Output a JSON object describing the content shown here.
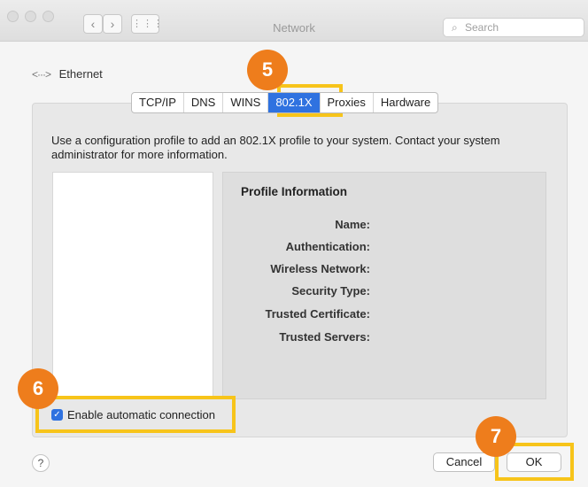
{
  "window": {
    "title": "Network"
  },
  "search": {
    "placeholder": "Search"
  },
  "breadcrumb": {
    "label": "Ethernet"
  },
  "tabs": [
    "TCP/IP",
    "DNS",
    "WINS",
    "802.1X",
    "Proxies",
    "Hardware"
  ],
  "active_tab": "802.1X",
  "description": "Use a configuration profile to add an 802.1X profile to your system. Contact your system administrator for more information.",
  "profile_info": {
    "heading": "Profile Information",
    "fields": [
      "Name:",
      "Authentication:",
      "Wireless Network:",
      "Security Type:",
      "Trusted Certificate:",
      "Trusted Servers:"
    ]
  },
  "auto_connect": {
    "label": "Enable automatic connection",
    "checked": true
  },
  "buttons": {
    "help": "?",
    "cancel": "Cancel",
    "ok": "OK"
  },
  "annotations": {
    "step5": "5",
    "step6": "6",
    "step7": "7"
  },
  "colors": {
    "accent": "#2f72e0",
    "highlight": "#f7c41a",
    "badge": "#ee7d1c"
  }
}
